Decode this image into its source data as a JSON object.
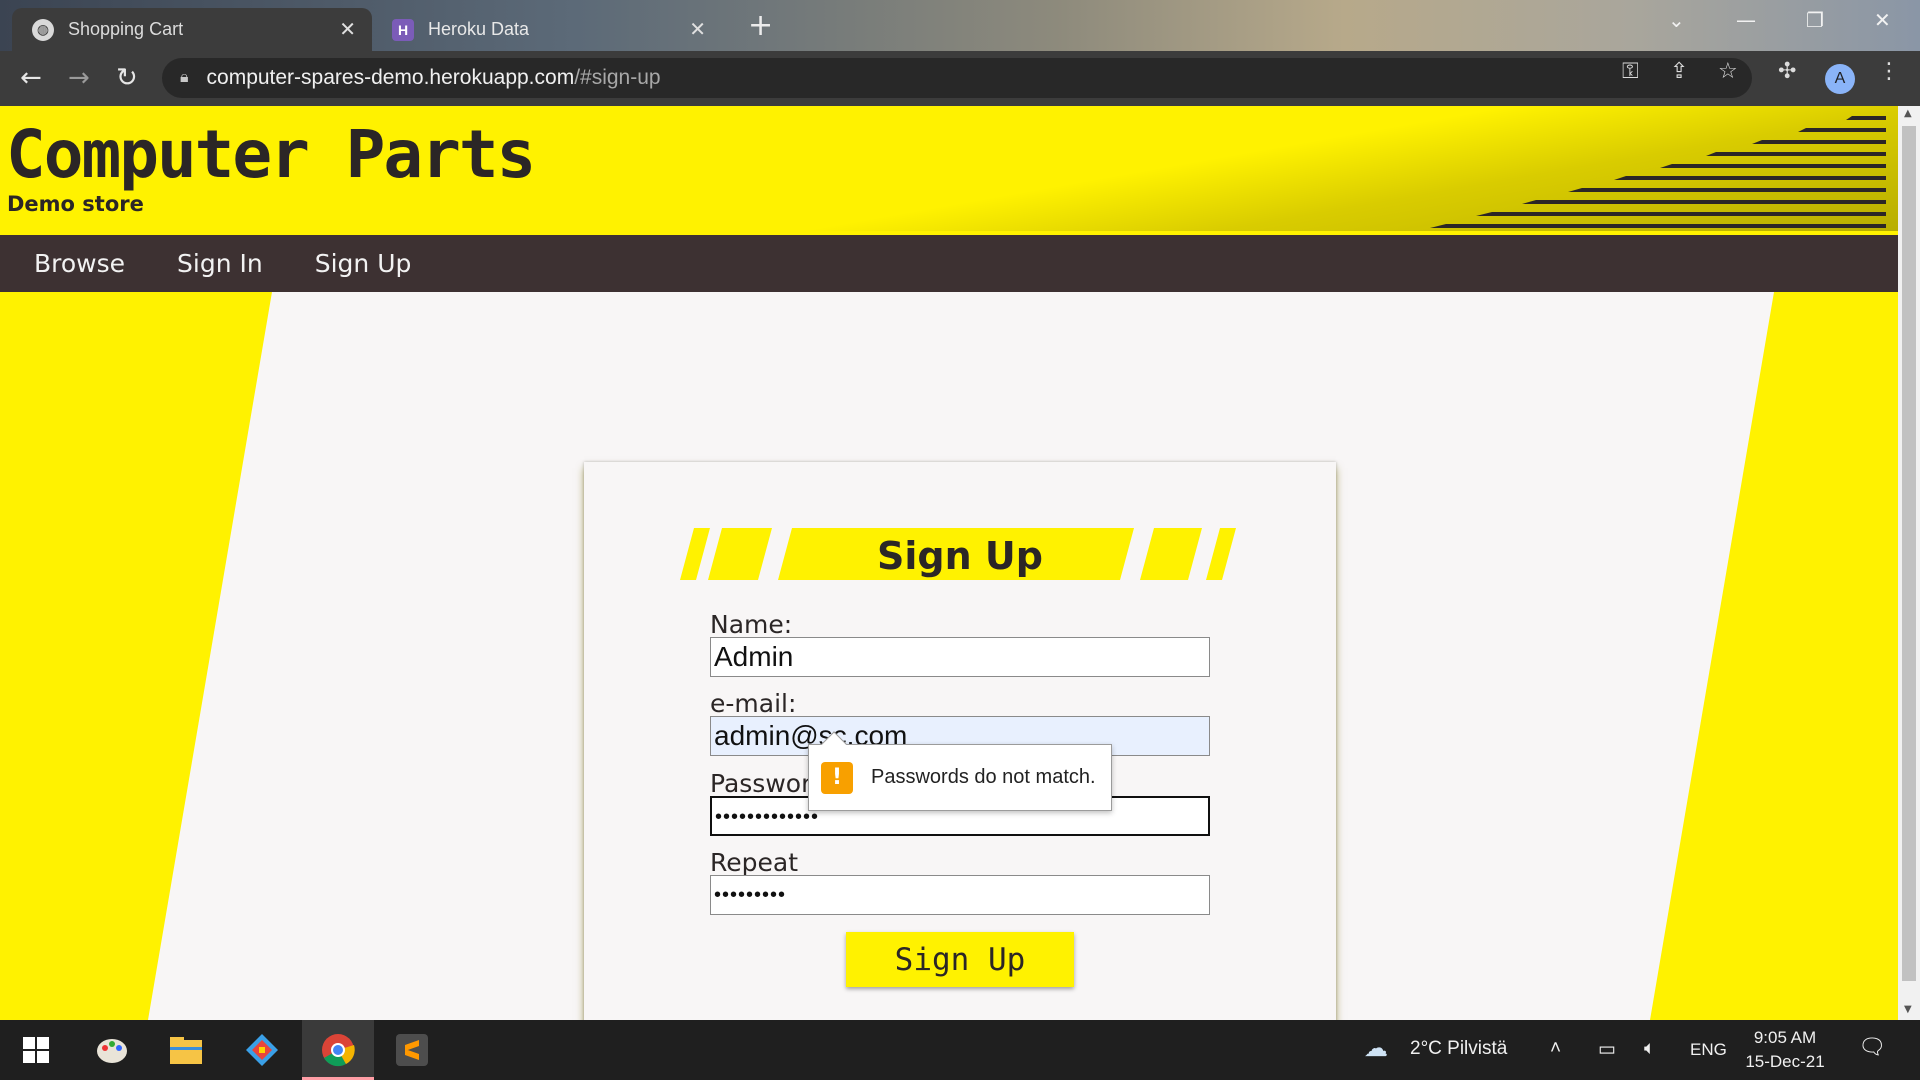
{
  "browser": {
    "tabs": [
      {
        "title": "Shopping Cart",
        "active": true
      },
      {
        "title": "Heroku Data",
        "active": false
      }
    ],
    "url_host": "computer-spares-demo.herokuapp.com",
    "url_path": "/#sign-up",
    "profile_initial": "A"
  },
  "site": {
    "title": "Computer Parts",
    "subtitle": "Demo store",
    "nav": [
      "Browse",
      "Sign In",
      "Sign Up"
    ],
    "colors": {
      "brand_yellow": "#fff200",
      "nav_dark": "#3d3132",
      "text_dark": "#2b2626"
    }
  },
  "form": {
    "heading": "Sign Up",
    "fields": [
      {
        "label": "Name:",
        "value": "Admin"
      },
      {
        "label": "e-mail:",
        "value": "admin@sc.com"
      },
      {
        "label": "Password:",
        "value": "•••••••••••••"
      },
      {
        "label": "Repeat",
        "value": "•••••••••"
      }
    ],
    "validation_message": "Passwords do not match.",
    "submit_label": "Sign Up"
  },
  "taskbar": {
    "weather": "2°C  Pilvistä",
    "language": "ENG",
    "time": "9:05 AM",
    "date": "15-Dec-21"
  }
}
